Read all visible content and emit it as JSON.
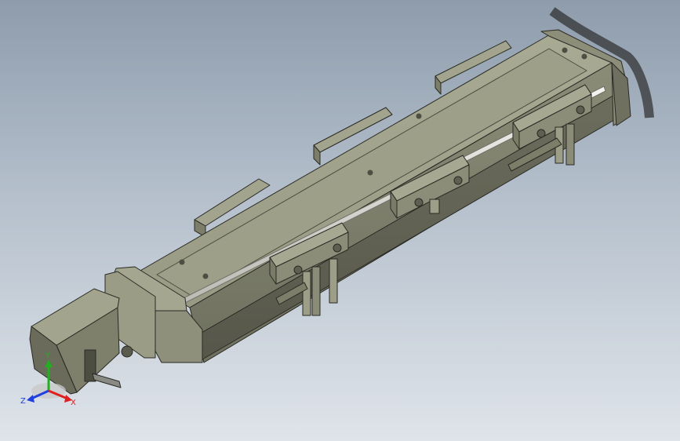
{
  "viewport": {
    "background_top": "#8e9cac",
    "background_bottom": "#dfe4ea",
    "model_color": "#a3a58f",
    "model_edge_color": "#2a2a24"
  },
  "triad": {
    "x_label": "X",
    "y_label": "Y",
    "z_label": "Z",
    "x_color": "#e02020",
    "y_color": "#20b020",
    "z_color": "#2040e0"
  }
}
